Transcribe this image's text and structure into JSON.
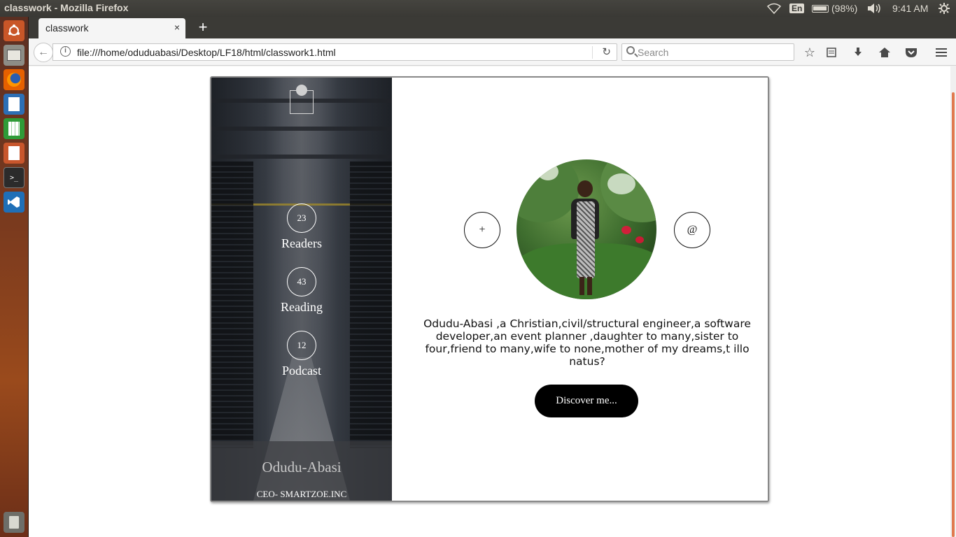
{
  "system": {
    "window_title": "classwork - Mozilla Firefox",
    "keyboard_layout": "En",
    "battery": "(98%)",
    "clock": "9:41 AM"
  },
  "launcher": {
    "icons": [
      "ubuntu-dash-icon",
      "files-icon",
      "firefox-icon",
      "writer-icon",
      "calc-icon",
      "impress-icon",
      "terminal-icon",
      "vscode-icon",
      "trash-icon"
    ]
  },
  "browser": {
    "tab_title": "classwork",
    "tab_close": "×",
    "new_tab": "+",
    "url": "file:///home/oduduabasi/Desktop/LF18/html/classwork1.html",
    "search_placeholder": "Search"
  },
  "page": {
    "sidebar": {
      "stats": [
        {
          "value": "23",
          "label": "Readers"
        },
        {
          "value": "43",
          "label": "Reading"
        },
        {
          "value": "12",
          "label": "Podcast"
        }
      ],
      "name": "Odudu-Abasi",
      "role": "CEO- SMARTZOE.INC"
    },
    "main": {
      "plus_label": "+",
      "at_label": "@",
      "bio": "Odudu-Abasi ,a Christian,civil/structural engineer,a software developer,an event planner ,daughter to many,sister to four,friend to many,wife to none,mother of my dreams,t illo natus?",
      "cta_label": "Discover me..."
    }
  },
  "colors": {
    "accent_scroll": "#e07a4f",
    "cta_bg": "#000000",
    "panel_bg": "#3b3a36"
  }
}
